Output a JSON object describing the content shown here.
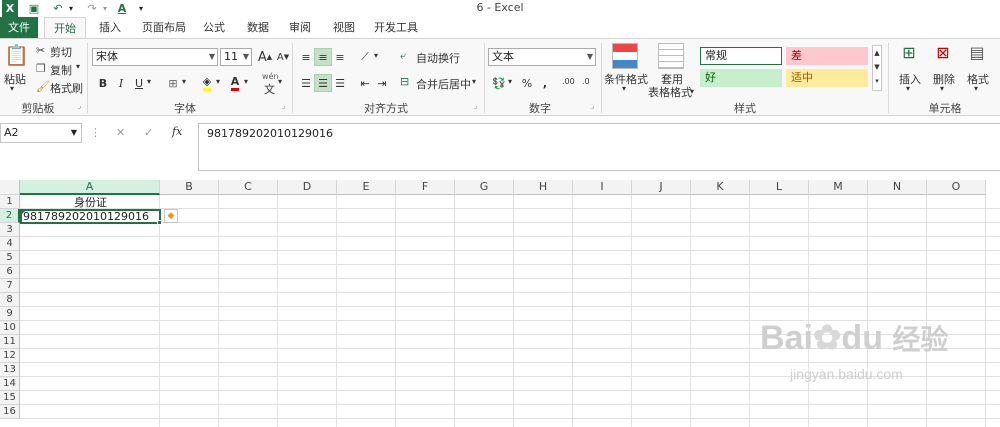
{
  "title_bar": {
    "title": "6 - Excel",
    "quick_access": {
      "undo": "↶",
      "redo": "↷",
      "customize": "▾"
    }
  },
  "tabs": [
    "文件",
    "开始",
    "插入",
    "页面布局",
    "公式",
    "数据",
    "审阅",
    "视图",
    "开发工具"
  ],
  "ribbon": {
    "clipboard": {
      "paste": "粘贴",
      "cut": "剪切",
      "copy": "复制",
      "format_painter": "格式刷",
      "label": "剪贴板"
    },
    "font": {
      "name": "宋体",
      "size": "11",
      "grow": "A",
      "shrink": "A",
      "bold": "B",
      "italic": "I",
      "underline": "U",
      "color_letter": "A",
      "wen": "wén",
      "wen_char": "文",
      "label": "字体"
    },
    "alignment": {
      "wrap": "自动换行",
      "merge": "合并后居中",
      "label": "对齐方式"
    },
    "number": {
      "format": "文本",
      "percent": "%",
      "comma": ",",
      "inc_decimal": ".00",
      "dec_decimal": ".0",
      "label": "数字"
    },
    "styles": {
      "conditional": "条件格式",
      "table_line1": "套用",
      "table_line2": "表格格式",
      "normal": "常规",
      "bad": "差",
      "good": "好",
      "neutral": "适中",
      "label": "样式"
    },
    "cells": {
      "insert": "插入",
      "delete": "删除",
      "format": "格式",
      "label": "单元格"
    }
  },
  "formula_bar": {
    "name_box": "A2",
    "cancel": "✕",
    "enter": "✓",
    "fx": "fx",
    "value": "981789202010129016"
  },
  "sheet": {
    "columns": [
      "A",
      "B",
      "C",
      "D",
      "E",
      "F",
      "G",
      "H",
      "I",
      "J",
      "K",
      "L",
      "M",
      "N",
      "O"
    ],
    "rows": [
      "1",
      "2",
      "3",
      "4",
      "5",
      "6",
      "7",
      "8",
      "9",
      "10",
      "11",
      "12",
      "13",
      "14",
      "15",
      "16"
    ],
    "cells": {
      "A1": "身份证",
      "A2": "981789202010129016"
    }
  },
  "watermark": {
    "brand": "Bai",
    "brand_du": "du",
    "cn": "经验",
    "url": "jingyan.baidu.com"
  },
  "colors": {
    "excel_green": "#217346",
    "bad_fill": "#ffc7ce",
    "good_fill": "#c6efce",
    "neutral_fill": "#ffeb9c"
  }
}
